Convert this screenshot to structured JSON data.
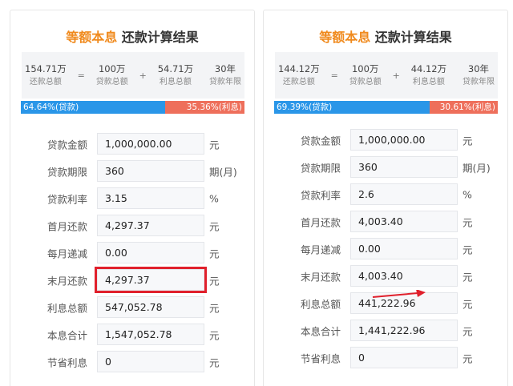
{
  "left": {
    "title_highlight": "等额本息",
    "title_rest": "还款计算结果",
    "summary": {
      "total_repay": {
        "value": "154.71万",
        "label": "还款总额"
      },
      "op1": "=",
      "principal": {
        "value": "100万",
        "label": "贷款总额"
      },
      "op2": "+",
      "interest": {
        "value": "54.71万",
        "label": "利息总额"
      },
      "years": {
        "value": "30年",
        "label": "贷款年限"
      }
    },
    "ratio": {
      "loan_label": "64.64%(贷款)",
      "interest_label": "35.36%(利息)",
      "loan_fraction": 0.6464
    },
    "rows": [
      {
        "label": "贷款金额",
        "value": "1,000,000.00",
        "unit": "元"
      },
      {
        "label": "贷款期限",
        "value": "360",
        "unit": "期(月)"
      },
      {
        "label": "贷款利率",
        "value": "3.15",
        "unit": "%"
      },
      {
        "label": "首月还款",
        "value": "4,297.37",
        "unit": "元"
      },
      {
        "label": "每月递减",
        "value": "0.00",
        "unit": "元"
      },
      {
        "label": "末月还款",
        "value": "4,297.37",
        "unit": "元"
      },
      {
        "label": "利息总额",
        "value": "547,052.78",
        "unit": "元"
      },
      {
        "label": "本息合计",
        "value": "1,547,052.78",
        "unit": "元"
      },
      {
        "label": "节省利息",
        "value": "0",
        "unit": "元"
      }
    ]
  },
  "right": {
    "title_highlight": "等额本息",
    "title_rest": "还款计算结果",
    "summary": {
      "total_repay": {
        "value": "144.12万",
        "label": "还款总额"
      },
      "op1": "=",
      "principal": {
        "value": "100万",
        "label": "贷款总额"
      },
      "op2": "+",
      "interest": {
        "value": "44.12万",
        "label": "利息总额"
      },
      "years": {
        "value": "30年",
        "label": "贷款年限"
      }
    },
    "ratio": {
      "loan_label": "69.39%(贷款)",
      "interest_label": "30.61%(利息)",
      "loan_fraction": 0.6939
    },
    "rows": [
      {
        "label": "贷款金额",
        "value": "1,000,000.00",
        "unit": "元"
      },
      {
        "label": "贷款期限",
        "value": "360",
        "unit": "期(月)"
      },
      {
        "label": "贷款利率",
        "value": "2.6",
        "unit": "%"
      },
      {
        "label": "首月还款",
        "value": "4,003.40",
        "unit": "元"
      },
      {
        "label": "每月递减",
        "value": "0.00",
        "unit": "元"
      },
      {
        "label": "末月还款",
        "value": "4,003.40",
        "unit": "元"
      },
      {
        "label": "利息总额",
        "value": "441,222.96",
        "unit": "元"
      },
      {
        "label": "本息合计",
        "value": "1,441,222.96",
        "unit": "元"
      },
      {
        "label": "节省利息",
        "value": "0",
        "unit": "元"
      }
    ]
  },
  "colors": {
    "accent_orange": "#f08a1d",
    "loan_blue": "#2a96e8",
    "interest_red": "#ee6f5b",
    "marker_red": "#e0202c"
  },
  "annotations": {
    "left_marked_row": "末月还款",
    "right_arrow_row": "末月还款"
  }
}
